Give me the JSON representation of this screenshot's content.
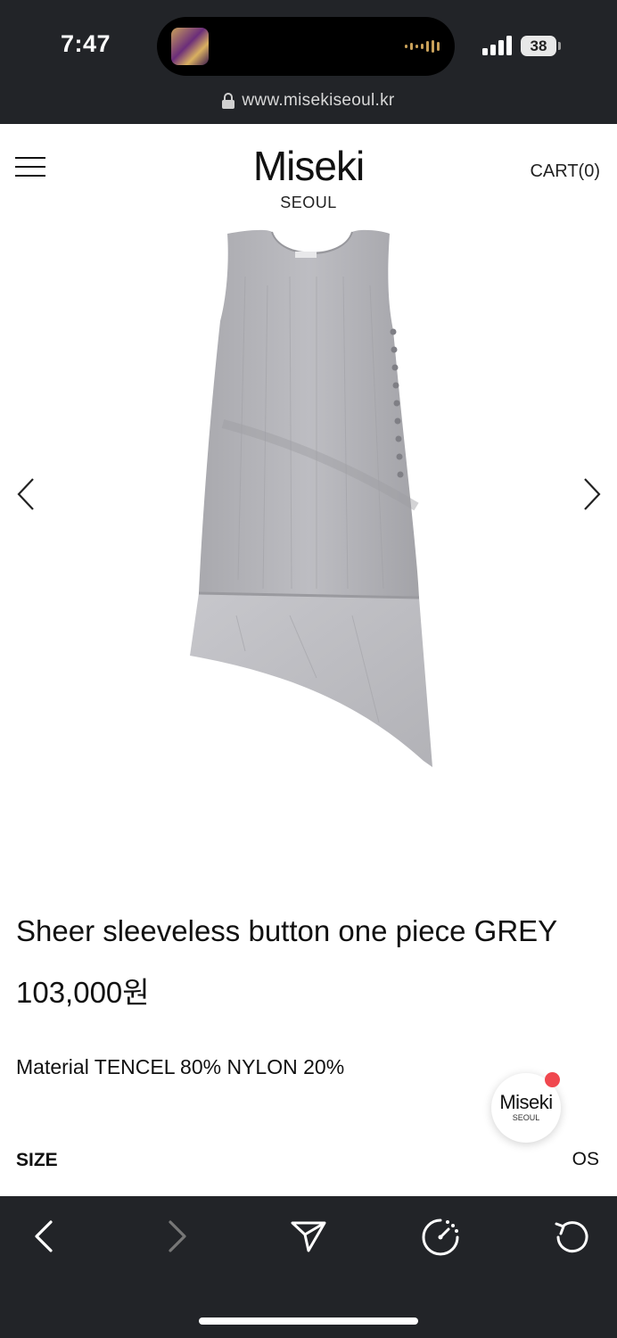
{
  "status_bar": {
    "time": "7:47",
    "battery": "38"
  },
  "browser": {
    "url": "www.misekiseoul.kr"
  },
  "header": {
    "brand_name": "Miseki",
    "brand_sub": "SEOUL",
    "cart_label": "CART(0)"
  },
  "product": {
    "title": "Sheer sleeveless button one piece GREY",
    "price": "103,000원",
    "material": "Material TENCEL 80% NYLON 20%",
    "size_label": "SIZE",
    "size_value": "OS",
    "image_color": "#b4b4b9"
  },
  "chat_widget": {
    "name": "Miseki",
    "sub": "SEOUL",
    "badge_color": "#f0474e"
  },
  "icons": {
    "status": [
      "signal-icon",
      "battery-icon",
      "lock-icon"
    ],
    "header": [
      "hamburger-menu-icon"
    ],
    "carousel": [
      "chevron-left-icon",
      "chevron-right-icon"
    ],
    "toolbar": [
      "back-icon",
      "forward-icon",
      "share-icon",
      "speed-icon",
      "reload-icon"
    ]
  },
  "colors": {
    "chrome_bg": "#222428",
    "page_bg": "#ffffff",
    "text": "#111111"
  }
}
